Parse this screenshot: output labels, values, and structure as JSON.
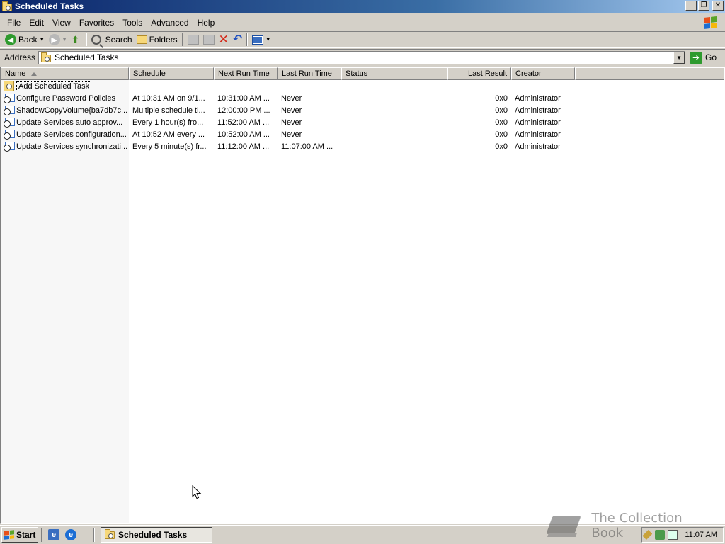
{
  "window": {
    "title": "Scheduled Tasks",
    "controls": {
      "minimize": "_",
      "restore": "❐",
      "close": "✕"
    }
  },
  "menu": {
    "items": [
      {
        "label": "File",
        "key": "F"
      },
      {
        "label": "Edit",
        "key": "E"
      },
      {
        "label": "View",
        "key": "V"
      },
      {
        "label": "Favorites",
        "key": "a"
      },
      {
        "label": "Tools",
        "key": "T"
      },
      {
        "label": "Advanced",
        "key": "d"
      },
      {
        "label": "Help",
        "key": "H"
      }
    ]
  },
  "toolbar": {
    "back_label": "Back",
    "search_label": "Search",
    "folders_label": "Folders"
  },
  "address": {
    "label": "Address",
    "value": "Scheduled Tasks",
    "go_label": "Go"
  },
  "list": {
    "columns": [
      {
        "label": "Name",
        "align": "left",
        "sorted": true
      },
      {
        "label": "Schedule",
        "align": "left"
      },
      {
        "label": "Next Run Time",
        "align": "left"
      },
      {
        "label": "Last Run Time",
        "align": "left"
      },
      {
        "label": "Status",
        "align": "left"
      },
      {
        "label": "Last Result",
        "align": "right"
      },
      {
        "label": "Creator",
        "align": "left"
      }
    ],
    "add_task_label": "Add Scheduled Task",
    "rows": [
      {
        "name": "Configure Password Policies",
        "schedule": "At 10:31 AM on 9/1...",
        "next_run": "10:31:00 AM ...",
        "last_run": "Never",
        "status": "",
        "last_result": "0x0",
        "creator": "Administrator"
      },
      {
        "name": "ShadowCopyVolume{ba7db7c...",
        "schedule": "Multiple schedule ti...",
        "next_run": "12:00:00 PM ...",
        "last_run": "Never",
        "status": "",
        "last_result": "0x0",
        "creator": "Administrator"
      },
      {
        "name": "Update Services auto approv...",
        "schedule": "Every 1 hour(s) fro...",
        "next_run": "11:52:00 AM ...",
        "last_run": "Never",
        "status": "",
        "last_result": "0x0",
        "creator": "Administrator"
      },
      {
        "name": "Update Services configuration...",
        "schedule": "At 10:52 AM every ...",
        "next_run": "10:52:00 AM ...",
        "last_run": "Never",
        "status": "",
        "last_result": "0x0",
        "creator": "Administrator"
      },
      {
        "name": "Update Services synchronizati...",
        "schedule": "Every 5 minute(s) fr...",
        "next_run": "11:12:00 AM ...",
        "last_run": "11:07:00 AM ...",
        "status": "",
        "last_result": "0x0",
        "creator": "Administrator"
      }
    ]
  },
  "taskbar": {
    "start_label": "Start",
    "task_button_label": "Scheduled Tasks",
    "clock": "11:07 AM"
  },
  "watermark": {
    "text": "The Collection Book"
  },
  "colors": {
    "titlebar_start": "#0a246a",
    "titlebar_end": "#a6caf0",
    "chrome": "#d4d0c8"
  }
}
